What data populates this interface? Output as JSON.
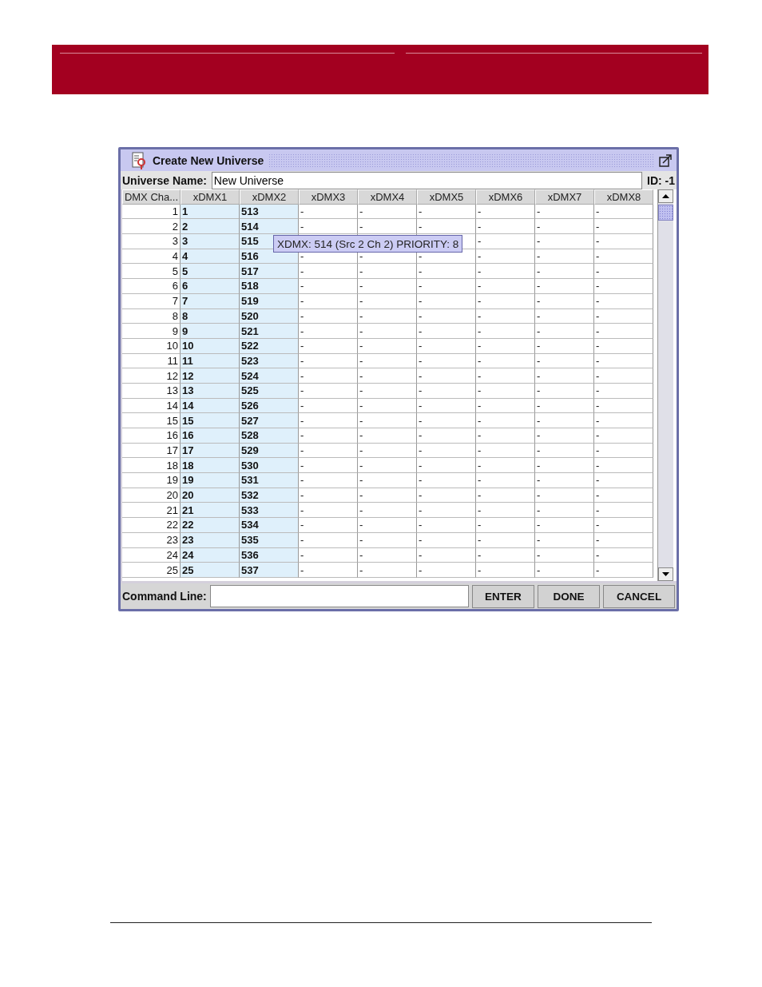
{
  "window": {
    "title": "Create New Universe"
  },
  "universe": {
    "label": "Universe Name:",
    "value": "New Universe",
    "id": "ID: -1"
  },
  "table": {
    "columns": [
      "DMX Cha...",
      "xDMX1",
      "xDMX2",
      "xDMX3",
      "xDMX4",
      "xDMX5",
      "xDMX6",
      "xDMX7",
      "xDMX8"
    ],
    "rows": [
      [
        "1",
        "1",
        "513",
        "-",
        "-",
        "-",
        "-",
        "-",
        "-"
      ],
      [
        "2",
        "2",
        "514",
        "-",
        "-",
        "-",
        "-",
        "-",
        "-"
      ],
      [
        "3",
        "3",
        "515",
        null,
        null,
        null,
        "-",
        "-",
        "-"
      ],
      [
        "4",
        "4",
        "516",
        "-",
        "-",
        "-",
        "-",
        "-",
        "-"
      ],
      [
        "5",
        "5",
        "517",
        "-",
        "-",
        "-",
        "-",
        "-",
        "-"
      ],
      [
        "6",
        "6",
        "518",
        "-",
        "-",
        "-",
        "-",
        "-",
        "-"
      ],
      [
        "7",
        "7",
        "519",
        "-",
        "-",
        "-",
        "-",
        "-",
        "-"
      ],
      [
        "8",
        "8",
        "520",
        "-",
        "-",
        "-",
        "-",
        "-",
        "-"
      ],
      [
        "9",
        "9",
        "521",
        "-",
        "-",
        "-",
        "-",
        "-",
        "-"
      ],
      [
        "10",
        "10",
        "522",
        "-",
        "-",
        "-",
        "-",
        "-",
        "-"
      ],
      [
        "11",
        "11",
        "523",
        "-",
        "-",
        "-",
        "-",
        "-",
        "-"
      ],
      [
        "12",
        "12",
        "524",
        "-",
        "-",
        "-",
        "-",
        "-",
        "-"
      ],
      [
        "13",
        "13",
        "525",
        "-",
        "-",
        "-",
        "-",
        "-",
        "-"
      ],
      [
        "14",
        "14",
        "526",
        "-",
        "-",
        "-",
        "-",
        "-",
        "-"
      ],
      [
        "15",
        "15",
        "527",
        "-",
        "-",
        "-",
        "-",
        "-",
        "-"
      ],
      [
        "16",
        "16",
        "528",
        "-",
        "-",
        "-",
        "-",
        "-",
        "-"
      ],
      [
        "17",
        "17",
        "529",
        "-",
        "-",
        "-",
        "-",
        "-",
        "-"
      ],
      [
        "18",
        "18",
        "530",
        "-",
        "-",
        "-",
        "-",
        "-",
        "-"
      ],
      [
        "19",
        "19",
        "531",
        "-",
        "-",
        "-",
        "-",
        "-",
        "-"
      ],
      [
        "20",
        "20",
        "532",
        "-",
        "-",
        "-",
        "-",
        "-",
        "-"
      ],
      [
        "21",
        "21",
        "533",
        "-",
        "-",
        "-",
        "-",
        "-",
        "-"
      ],
      [
        "22",
        "22",
        "534",
        "-",
        "-",
        "-",
        "-",
        "-",
        "-"
      ],
      [
        "23",
        "23",
        "535",
        "-",
        "-",
        "-",
        "-",
        "-",
        "-"
      ],
      [
        "24",
        "24",
        "536",
        "-",
        "-",
        "-",
        "-",
        "-",
        "-"
      ],
      [
        "25",
        "25",
        "537",
        "-",
        "-",
        "-",
        "-",
        "-",
        "-"
      ]
    ],
    "tooltip": "XDMX: 514 (Src 2 Ch 2) PRIORITY: 8"
  },
  "command_line": {
    "label": "Command Line:"
  },
  "buttons": [
    "ENTER",
    "DONE",
    "CANCEL"
  ]
}
